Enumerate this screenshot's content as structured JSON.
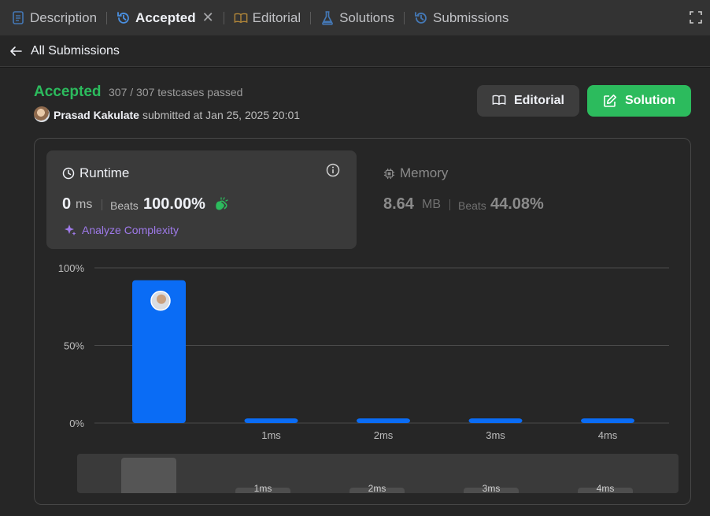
{
  "tabs": [
    {
      "label": "Description",
      "icon": "description-icon"
    },
    {
      "label": "Accepted",
      "icon": "history-icon",
      "active": true
    },
    {
      "label": "Editorial",
      "icon": "book-icon"
    },
    {
      "label": "Solutions",
      "icon": "flask-icon"
    },
    {
      "label": "Submissions",
      "icon": "history-icon"
    }
  ],
  "subbar": {
    "back_label": "All Submissions"
  },
  "result": {
    "status": "Accepted",
    "testcases": "307 / 307 testcases passed",
    "author": "Prasad Kakulate",
    "submitted": "submitted at Jan 25, 2025 20:01"
  },
  "buttons": {
    "editorial": "Editorial",
    "solution": "Solution"
  },
  "runtime": {
    "title": "Runtime",
    "value": "0",
    "unit": "ms",
    "beats_label": "Beats",
    "beats_value": "100.00%",
    "analyze_label": "Analyze Complexity"
  },
  "memory": {
    "title": "Memory",
    "value": "8.64",
    "unit": "MB",
    "beats_label": "Beats",
    "beats_value": "44.08%"
  },
  "colors": {
    "accepted": "#2cbb5d",
    "bar": "#0a6cf5",
    "analyze": "#9f7aea"
  },
  "chart_data": {
    "type": "bar",
    "categories": [
      "",
      "1ms",
      "2ms",
      "3ms",
      "4ms"
    ],
    "values": [
      92,
      3,
      3,
      3,
      3
    ],
    "yticks": [
      "100%",
      "50%",
      "0%"
    ],
    "ylim": [
      0,
      100
    ],
    "grid": true
  },
  "minimap": {
    "labels": [
      "1ms",
      "2ms",
      "3ms",
      "4ms"
    ]
  }
}
